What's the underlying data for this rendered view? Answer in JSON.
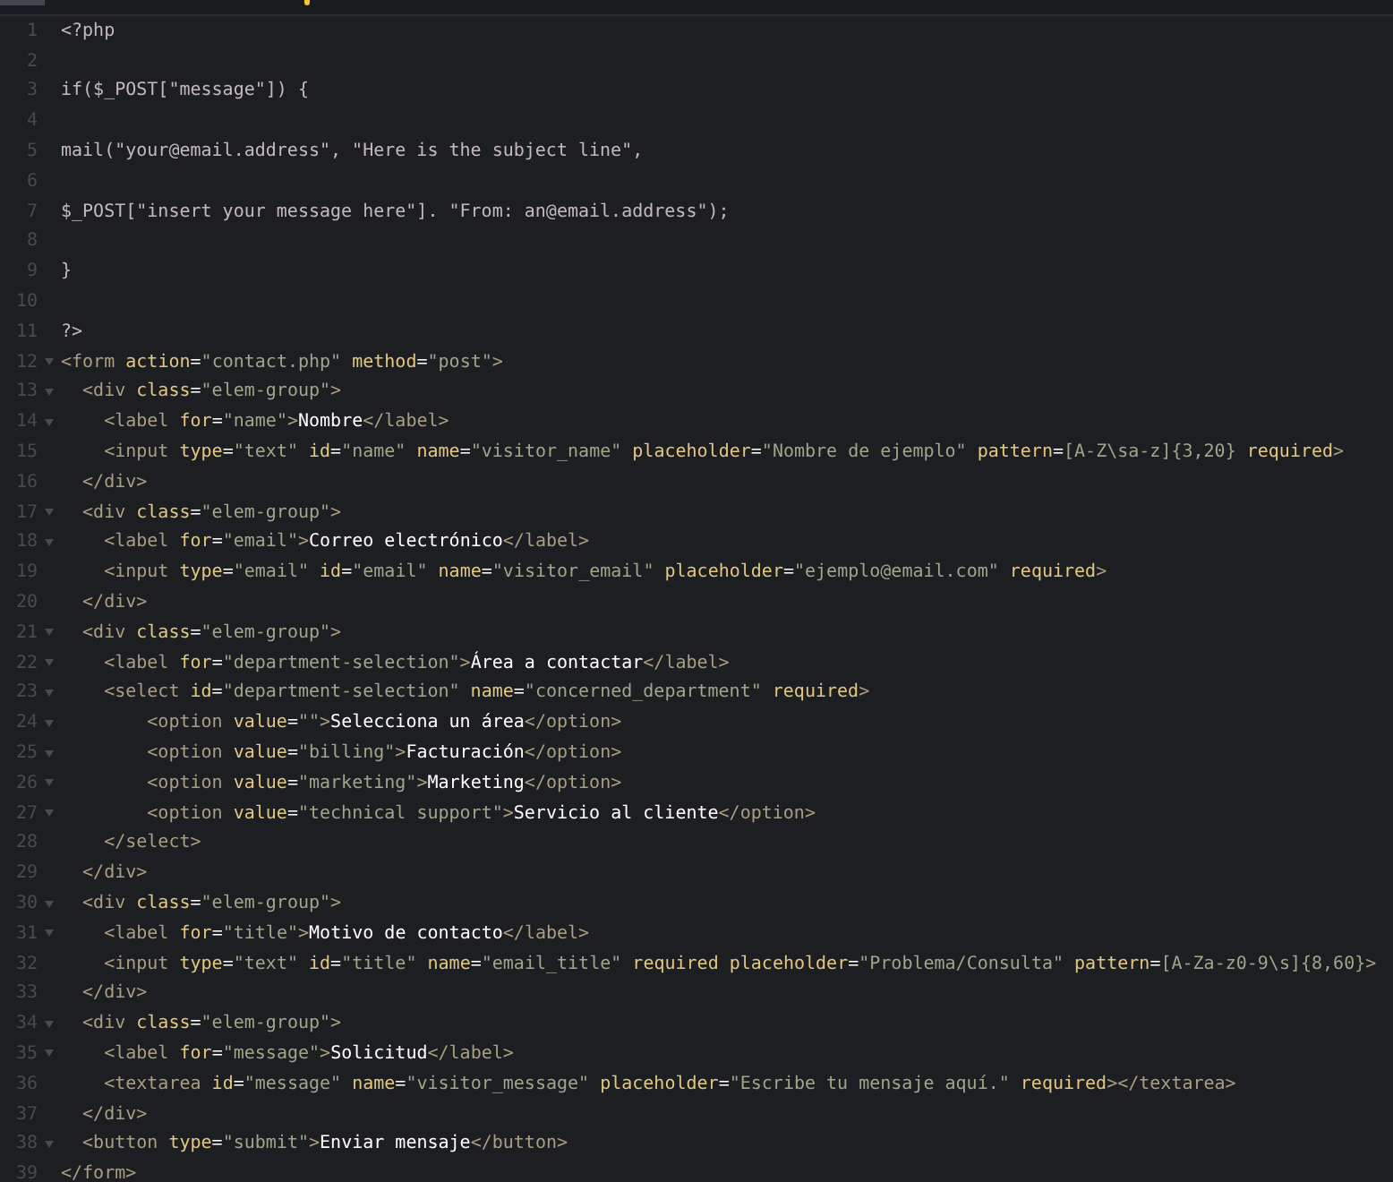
{
  "editor": {
    "lines": [
      {
        "number": "1",
        "foldable": false,
        "tokens": [
          {
            "kind": "plain",
            "text": "<?php"
          }
        ]
      },
      {
        "number": "2",
        "foldable": false
      },
      {
        "number": "3",
        "foldable": false,
        "tokens": [
          {
            "kind": "plain",
            "text": "if($_POST[\"message\"]) {"
          }
        ]
      },
      {
        "number": "4",
        "foldable": false
      },
      {
        "number": "5",
        "foldable": false,
        "tokens": [
          {
            "kind": "plain",
            "text": "mail(\"your@email.address\", \"Here is the subject line\","
          }
        ]
      },
      {
        "number": "6",
        "foldable": false
      },
      {
        "number": "7",
        "foldable": false,
        "tokens": [
          {
            "kind": "plain",
            "text": "$_POST[\"insert your message here\"]. \"From: an@email.address\");"
          }
        ]
      },
      {
        "number": "8",
        "foldable": false
      },
      {
        "number": "9",
        "foldable": false,
        "tokens": [
          {
            "kind": "plain",
            "text": "}"
          }
        ]
      },
      {
        "number": "10",
        "foldable": false
      },
      {
        "number": "11",
        "foldable": false,
        "tokens": [
          {
            "kind": "plain",
            "text": "?>"
          }
        ]
      },
      {
        "number": "12",
        "foldable": true,
        "tokens": [
          {
            "kind": "tag",
            "text": "<form"
          },
          {
            "kind": "attr",
            "text": " action"
          },
          {
            "kind": "punct",
            "text": "="
          },
          {
            "kind": "string",
            "text": "\"contact.php\""
          },
          {
            "kind": "attr",
            "text": " method"
          },
          {
            "kind": "punct",
            "text": "="
          },
          {
            "kind": "string",
            "text": "\"post\""
          },
          {
            "kind": "tag",
            "text": ">"
          }
        ]
      },
      {
        "number": "13",
        "foldable": true,
        "tokens": [
          {
            "kind": "tag",
            "text": "  <div"
          },
          {
            "kind": "attr",
            "text": " class"
          },
          {
            "kind": "punct",
            "text": "="
          },
          {
            "kind": "string",
            "text": "\"elem-group\""
          },
          {
            "kind": "tag",
            "text": ">"
          }
        ]
      },
      {
        "number": "14",
        "foldable": true,
        "tokens": [
          {
            "kind": "tag",
            "text": "    <label"
          },
          {
            "kind": "attr",
            "text": " for"
          },
          {
            "kind": "punct",
            "text": "="
          },
          {
            "kind": "string",
            "text": "\"name\""
          },
          {
            "kind": "tag",
            "text": ">"
          },
          {
            "kind": "text",
            "text": "Nombre"
          },
          {
            "kind": "tag",
            "text": "</label>"
          }
        ]
      },
      {
        "number": "15",
        "foldable": false,
        "tokens": [
          {
            "kind": "tag",
            "text": "    <input"
          },
          {
            "kind": "attr",
            "text": " type"
          },
          {
            "kind": "punct",
            "text": "="
          },
          {
            "kind": "string",
            "text": "\"text\""
          },
          {
            "kind": "attr",
            "text": " id"
          },
          {
            "kind": "punct",
            "text": "="
          },
          {
            "kind": "string",
            "text": "\"name\""
          },
          {
            "kind": "attr",
            "text": " name"
          },
          {
            "kind": "punct",
            "text": "="
          },
          {
            "kind": "string",
            "text": "\"visitor_name\""
          },
          {
            "kind": "attr",
            "text": " placeholder"
          },
          {
            "kind": "punct",
            "text": "="
          },
          {
            "kind": "string",
            "text": "\"Nombre de ejemplo\""
          },
          {
            "kind": "attr",
            "text": " pattern"
          },
          {
            "kind": "punct",
            "text": "="
          },
          {
            "kind": "string",
            "text": "[A-Z\\sa-z]{3,20}"
          },
          {
            "kind": "attr",
            "text": " required"
          },
          {
            "kind": "tag",
            "text": ">"
          }
        ]
      },
      {
        "number": "16",
        "foldable": false,
        "tokens": [
          {
            "kind": "tag",
            "text": "  </div>"
          }
        ]
      },
      {
        "number": "17",
        "foldable": true,
        "tokens": [
          {
            "kind": "tag",
            "text": "  <div"
          },
          {
            "kind": "attr",
            "text": " class"
          },
          {
            "kind": "punct",
            "text": "="
          },
          {
            "kind": "string",
            "text": "\"elem-group\""
          },
          {
            "kind": "tag",
            "text": ">"
          }
        ]
      },
      {
        "number": "18",
        "foldable": true,
        "tokens": [
          {
            "kind": "tag",
            "text": "    <label"
          },
          {
            "kind": "attr",
            "text": " for"
          },
          {
            "kind": "punct",
            "text": "="
          },
          {
            "kind": "string",
            "text": "\"email\""
          },
          {
            "kind": "tag",
            "text": ">"
          },
          {
            "kind": "text",
            "text": "Correo electrónico"
          },
          {
            "kind": "tag",
            "text": "</label>"
          }
        ]
      },
      {
        "number": "19",
        "foldable": false,
        "tokens": [
          {
            "kind": "tag",
            "text": "    <input"
          },
          {
            "kind": "attr",
            "text": " type"
          },
          {
            "kind": "punct",
            "text": "="
          },
          {
            "kind": "string",
            "text": "\"email\""
          },
          {
            "kind": "attr",
            "text": " id"
          },
          {
            "kind": "punct",
            "text": "="
          },
          {
            "kind": "string",
            "text": "\"email\""
          },
          {
            "kind": "attr",
            "text": " name"
          },
          {
            "kind": "punct",
            "text": "="
          },
          {
            "kind": "string",
            "text": "\"visitor_email\""
          },
          {
            "kind": "attr",
            "text": " placeholder"
          },
          {
            "kind": "punct",
            "text": "="
          },
          {
            "kind": "string",
            "text": "\"ejemplo@email.com\""
          },
          {
            "kind": "attr",
            "text": " required"
          },
          {
            "kind": "tag",
            "text": ">"
          }
        ]
      },
      {
        "number": "20",
        "foldable": false,
        "tokens": [
          {
            "kind": "tag",
            "text": "  </div>"
          }
        ]
      },
      {
        "number": "21",
        "foldable": true,
        "tokens": [
          {
            "kind": "tag",
            "text": "  <div"
          },
          {
            "kind": "attr",
            "text": " class"
          },
          {
            "kind": "punct",
            "text": "="
          },
          {
            "kind": "string",
            "text": "\"elem-group\""
          },
          {
            "kind": "tag",
            "text": ">"
          }
        ]
      },
      {
        "number": "22",
        "foldable": true,
        "tokens": [
          {
            "kind": "tag",
            "text": "    <label"
          },
          {
            "kind": "attr",
            "text": " for"
          },
          {
            "kind": "punct",
            "text": "="
          },
          {
            "kind": "string",
            "text": "\"department-selection\""
          },
          {
            "kind": "tag",
            "text": ">"
          },
          {
            "kind": "text",
            "text": "Área a contactar"
          },
          {
            "kind": "tag",
            "text": "</label>"
          }
        ]
      },
      {
        "number": "23",
        "foldable": true,
        "tokens": [
          {
            "kind": "tag",
            "text": "    <select"
          },
          {
            "kind": "attr",
            "text": " id"
          },
          {
            "kind": "punct",
            "text": "="
          },
          {
            "kind": "string",
            "text": "\"department-selection\""
          },
          {
            "kind": "attr",
            "text": " name"
          },
          {
            "kind": "punct",
            "text": "="
          },
          {
            "kind": "string",
            "text": "\"concerned_department\""
          },
          {
            "kind": "attr",
            "text": " required"
          },
          {
            "kind": "tag",
            "text": ">"
          }
        ]
      },
      {
        "number": "24",
        "foldable": true,
        "tokens": [
          {
            "kind": "tag",
            "text": "        <option"
          },
          {
            "kind": "attr",
            "text": " value"
          },
          {
            "kind": "punct",
            "text": "="
          },
          {
            "kind": "string",
            "text": "\"\""
          },
          {
            "kind": "tag",
            "text": ">"
          },
          {
            "kind": "text",
            "text": "Selecciona un área"
          },
          {
            "kind": "tag",
            "text": "</option>"
          }
        ]
      },
      {
        "number": "25",
        "foldable": true,
        "tokens": [
          {
            "kind": "tag",
            "text": "        <option"
          },
          {
            "kind": "attr",
            "text": " value"
          },
          {
            "kind": "punct",
            "text": "="
          },
          {
            "kind": "string",
            "text": "\"billing\""
          },
          {
            "kind": "tag",
            "text": ">"
          },
          {
            "kind": "text",
            "text": "Facturación"
          },
          {
            "kind": "tag",
            "text": "</option>"
          }
        ]
      },
      {
        "number": "26",
        "foldable": true,
        "tokens": [
          {
            "kind": "tag",
            "text": "        <option"
          },
          {
            "kind": "attr",
            "text": " value"
          },
          {
            "kind": "punct",
            "text": "="
          },
          {
            "kind": "string",
            "text": "\"marketing\""
          },
          {
            "kind": "tag",
            "text": ">"
          },
          {
            "kind": "text",
            "text": "Marketing"
          },
          {
            "kind": "tag",
            "text": "</option>"
          }
        ]
      },
      {
        "number": "27",
        "foldable": true,
        "tokens": [
          {
            "kind": "tag",
            "text": "        <option"
          },
          {
            "kind": "attr",
            "text": " value"
          },
          {
            "kind": "punct",
            "text": "="
          },
          {
            "kind": "string",
            "text": "\"technical support\""
          },
          {
            "kind": "tag",
            "text": ">"
          },
          {
            "kind": "text",
            "text": "Servicio al cliente"
          },
          {
            "kind": "tag",
            "text": "</option>"
          }
        ]
      },
      {
        "number": "28",
        "foldable": false,
        "tokens": [
          {
            "kind": "tag",
            "text": "    </select>"
          }
        ]
      },
      {
        "number": "29",
        "foldable": false,
        "tokens": [
          {
            "kind": "tag",
            "text": "  </div>"
          }
        ]
      },
      {
        "number": "30",
        "foldable": true,
        "tokens": [
          {
            "kind": "tag",
            "text": "  <div"
          },
          {
            "kind": "attr",
            "text": " class"
          },
          {
            "kind": "punct",
            "text": "="
          },
          {
            "kind": "string",
            "text": "\"elem-group\""
          },
          {
            "kind": "tag",
            "text": ">"
          }
        ]
      },
      {
        "number": "31",
        "foldable": true,
        "tokens": [
          {
            "kind": "tag",
            "text": "    <label"
          },
          {
            "kind": "attr",
            "text": " for"
          },
          {
            "kind": "punct",
            "text": "="
          },
          {
            "kind": "string",
            "text": "\"title\""
          },
          {
            "kind": "tag",
            "text": ">"
          },
          {
            "kind": "text",
            "text": "Motivo de contacto"
          },
          {
            "kind": "tag",
            "text": "</label>"
          }
        ]
      },
      {
        "number": "32",
        "foldable": false,
        "tokens": [
          {
            "kind": "tag",
            "text": "    <input"
          },
          {
            "kind": "attr",
            "text": " type"
          },
          {
            "kind": "punct",
            "text": "="
          },
          {
            "kind": "string",
            "text": "\"text\""
          },
          {
            "kind": "attr",
            "text": " id"
          },
          {
            "kind": "punct",
            "text": "="
          },
          {
            "kind": "string",
            "text": "\"title\""
          },
          {
            "kind": "attr",
            "text": " name"
          },
          {
            "kind": "punct",
            "text": "="
          },
          {
            "kind": "string",
            "text": "\"email_title\""
          },
          {
            "kind": "attr",
            "text": " required"
          },
          {
            "kind": "attr",
            "text": " placeholder"
          },
          {
            "kind": "punct",
            "text": "="
          },
          {
            "kind": "string",
            "text": "\"Problema/Consulta\""
          },
          {
            "kind": "attr",
            "text": " pattern"
          },
          {
            "kind": "punct",
            "text": "="
          },
          {
            "kind": "string",
            "text": "[A-Za-z0-9\\s]{8,60}"
          },
          {
            "kind": "tag",
            "text": ">"
          }
        ]
      },
      {
        "number": "33",
        "foldable": false,
        "tokens": [
          {
            "kind": "tag",
            "text": "  </div>"
          }
        ]
      },
      {
        "number": "34",
        "foldable": true,
        "tokens": [
          {
            "kind": "tag",
            "text": "  <div"
          },
          {
            "kind": "attr",
            "text": " class"
          },
          {
            "kind": "punct",
            "text": "="
          },
          {
            "kind": "string",
            "text": "\"elem-group\""
          },
          {
            "kind": "tag",
            "text": ">"
          }
        ]
      },
      {
        "number": "35",
        "foldable": true,
        "tokens": [
          {
            "kind": "tag",
            "text": "    <label"
          },
          {
            "kind": "attr",
            "text": " for"
          },
          {
            "kind": "punct",
            "text": "="
          },
          {
            "kind": "string",
            "text": "\"message\""
          },
          {
            "kind": "tag",
            "text": ">"
          },
          {
            "kind": "text",
            "text": "Solicitud"
          },
          {
            "kind": "tag",
            "text": "</label>"
          }
        ]
      },
      {
        "number": "36",
        "foldable": false,
        "tokens": [
          {
            "kind": "tag",
            "text": "    <textarea"
          },
          {
            "kind": "attr",
            "text": " id"
          },
          {
            "kind": "punct",
            "text": "="
          },
          {
            "kind": "string",
            "text": "\"message\""
          },
          {
            "kind": "attr",
            "text": " name"
          },
          {
            "kind": "punct",
            "text": "="
          },
          {
            "kind": "string",
            "text": "\"visitor_message\""
          },
          {
            "kind": "attr",
            "text": " placeholder"
          },
          {
            "kind": "punct",
            "text": "="
          },
          {
            "kind": "string",
            "text": "\"Escribe tu mensaje aquí.\""
          },
          {
            "kind": "attr",
            "text": " required"
          },
          {
            "kind": "tag",
            "text": "></textarea>"
          }
        ]
      },
      {
        "number": "37",
        "foldable": false,
        "tokens": [
          {
            "kind": "tag",
            "text": "  </div>"
          }
        ]
      },
      {
        "number": "38",
        "foldable": true,
        "tokens": [
          {
            "kind": "tag",
            "text": "  <button"
          },
          {
            "kind": "attr",
            "text": " type"
          },
          {
            "kind": "punct",
            "text": "="
          },
          {
            "kind": "string",
            "text": "\"submit\""
          },
          {
            "kind": "tag",
            "text": ">"
          },
          {
            "kind": "text",
            "text": "Enviar mensaje"
          },
          {
            "kind": "tag",
            "text": "</button>"
          }
        ]
      },
      {
        "number": "39",
        "foldable": false,
        "tokens": [
          {
            "kind": "tag",
            "text": "</form>"
          }
        ]
      }
    ]
  }
}
